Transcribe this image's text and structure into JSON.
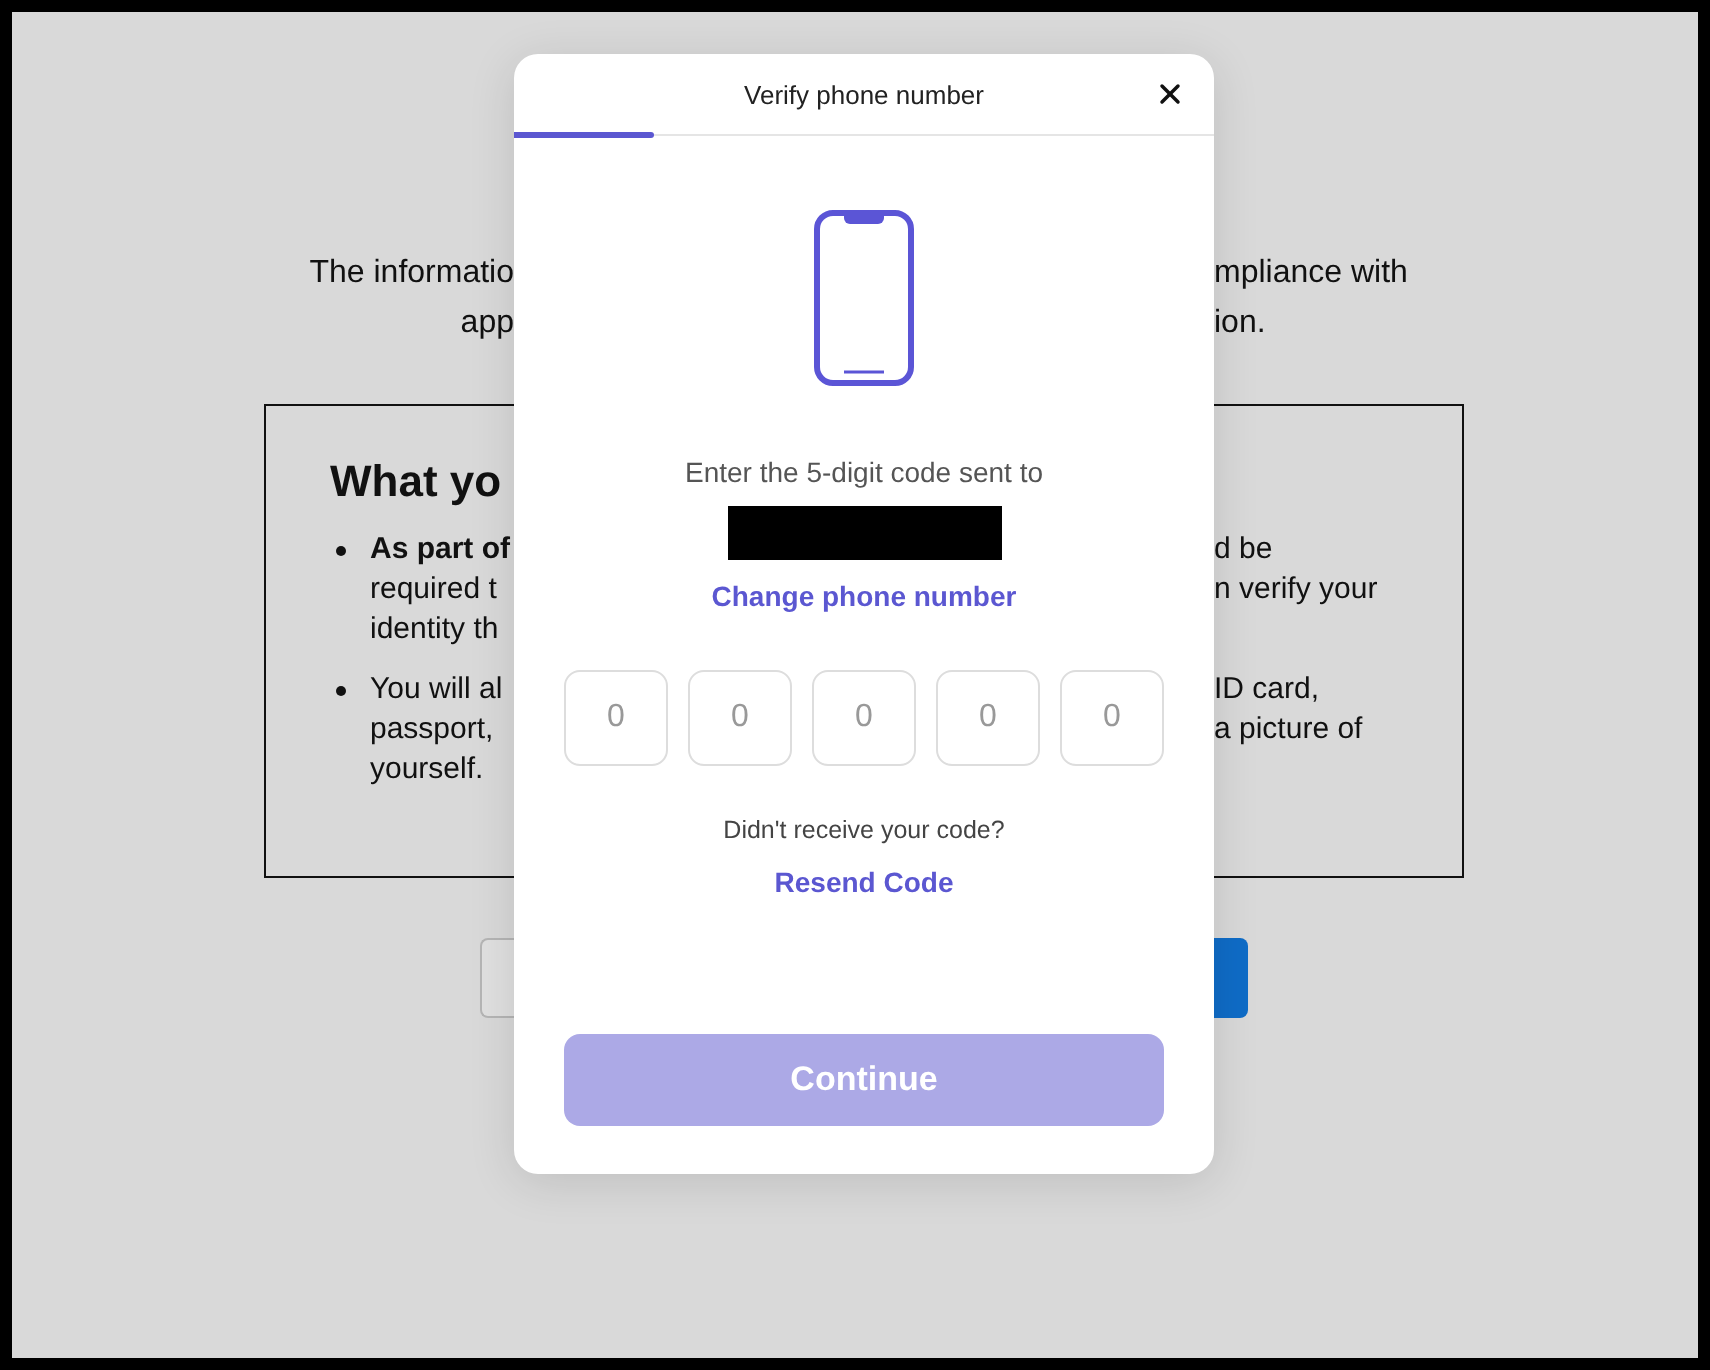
{
  "intro": {
    "lines": [
      {
        "left": "The informatio",
        "right": "mpliance with"
      },
      {
        "left": "app",
        "right": "ion."
      }
    ]
  },
  "info_box": {
    "heading": "What yo",
    "bullets": [
      {
        "lines": [
          {
            "left": "**As part of**",
            "right": "d be"
          },
          {
            "left": "required t",
            "right": "n verify your"
          },
          {
            "left": "identity th"
          }
        ]
      },
      {
        "lines": [
          {
            "left": "You will al",
            "right": "ID card,"
          },
          {
            "left": "passport,",
            "right": "a picture of"
          },
          {
            "left": "yourself."
          }
        ]
      }
    ]
  },
  "modal": {
    "title": "Verify phone number",
    "progress": {
      "level": 0.2
    },
    "prompt": "Enter the 5-digit code sent to",
    "change_link": "Change phone number",
    "code_fields": [
      {
        "placeholder": "0"
      },
      {
        "placeholder": "0"
      },
      {
        "placeholder": "0"
      },
      {
        "placeholder": "0"
      },
      {
        "placeholder": "0"
      }
    ],
    "resend_prompt": "Didn't receive your code?",
    "resend_link": "Resend Code",
    "continue_button": {
      "label": "Continue",
      "disabled": true
    }
  }
}
